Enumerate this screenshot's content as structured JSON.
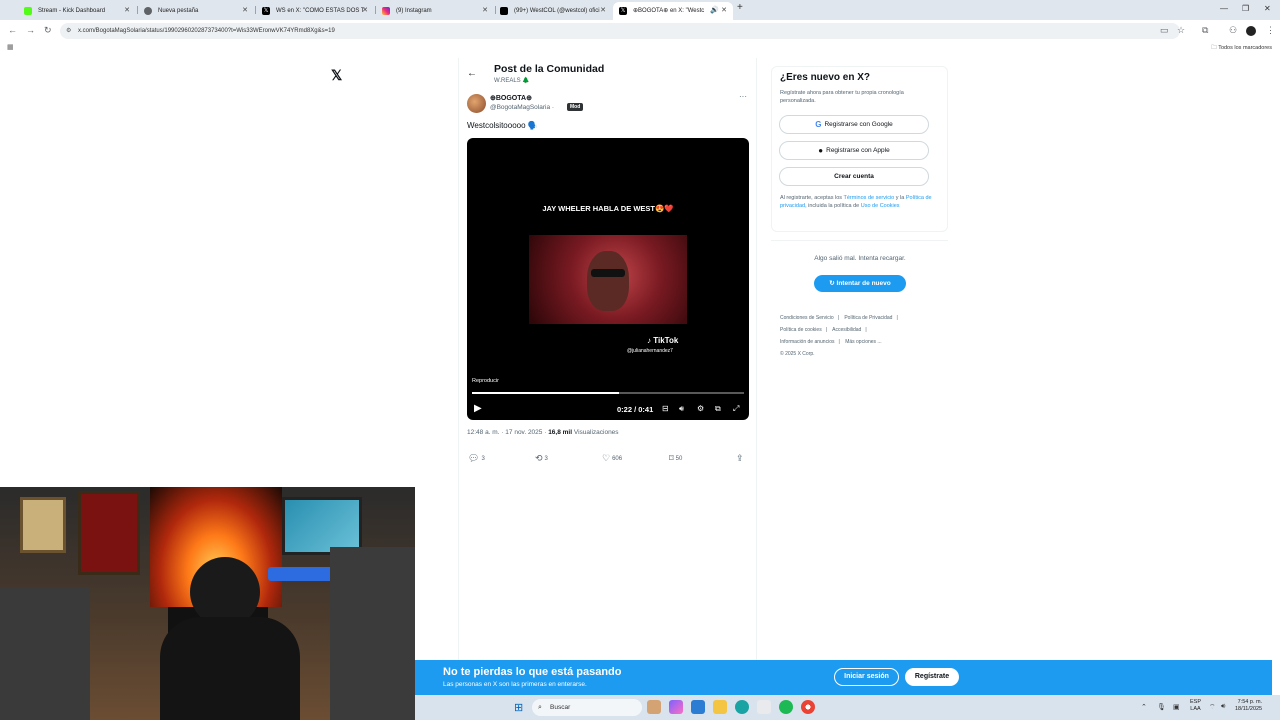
{
  "browser": {
    "tabs": [
      {
        "label": "Stream - Kick Dashboard",
        "color": "#53fc18"
      },
      {
        "label": "Nueva pestaña",
        "color": "#5f6368"
      },
      {
        "label": "WS en X: \"COMO ESTAS DOS T",
        "color": "#000000"
      },
      {
        "label": "(9) Instagram",
        "color": "#e1306c"
      },
      {
        "label": "(99+) WestCOL (@westcol) ofici",
        "color": "#000000"
      },
      {
        "label": "⊕BOGOTA⊕ en X: \"Westc",
        "color": "#000000"
      }
    ],
    "url": "x.com/BogotaMagSolaria/status/1990296020287373400?t=Wis33WEronwVK74YRmd8Xg&s=19",
    "bookmarks_all": "Todos los marcadores"
  },
  "header": {
    "title": "Post de la Comunidad",
    "community": "W.REALS 🌲"
  },
  "post": {
    "author_name": "⊕BOGOTA⊕",
    "author_handle": "@BogotaMagSolaria ·",
    "mod_badge": "Mod",
    "text": "Westcolsitooooo 🗣️",
    "video": {
      "caption": "JAY WHELER HABLA DE WEST😍❤️",
      "tiktok_label": "TikTok",
      "tiktok_user": "@julianahernandez7",
      "overlay_label": "Reproducir",
      "time": "0:22 / 0:41",
      "progress": 0.54
    },
    "meta": {
      "date": "12:48 a. m. · 17 nov. 2025 ·",
      "views_count": "16,8 mil",
      "views_label": "Visualizaciones"
    },
    "actions": {
      "replies": "3",
      "reposts": "3",
      "likes": "606",
      "bookmarks": "50"
    }
  },
  "sidebar": {
    "signup_title": "¿Eres nuevo en X?",
    "signup_desc": "Regístrate ahora para obtener tu propia cronología personalizada.",
    "google_btn": "Registrarse con Google",
    "apple_btn": "Registrarse con Apple",
    "create_btn": "Crear cuenta",
    "terms_prefix": "Al registrarte, aceptas los",
    "terms_link": "Términos de servicio",
    "terms_mid": "y la",
    "privacy_link": "Política de privacidad",
    "terms_suffix": ", incluida la política de",
    "cookies_link": "Uso de Cookies",
    "error_msg": "Algo salió mal. Intenta recargar.",
    "retry_btn": "Intentar de nuevo",
    "footer": [
      "Condiciones de Servicio",
      "|",
      "Política de Privacidad",
      "|",
      "Política de cookies",
      "|",
      "Accesibilidad",
      "|",
      "Información de anuncios",
      "|",
      "Más opciones ...",
      "© 2025 X Corp."
    ]
  },
  "banner": {
    "title": "No te pierdas lo que está pasando",
    "subtitle": "Las personas en X son las primeras en enterarse.",
    "login_btn": "Iniciar sesión",
    "register_btn": "Regístrate"
  },
  "taskbar": {
    "search_placeholder": "Buscar",
    "lang_line1": "ESP",
    "lang_line2": "LAA",
    "time": "7:54 p. m.",
    "date": "18/11/2025"
  }
}
